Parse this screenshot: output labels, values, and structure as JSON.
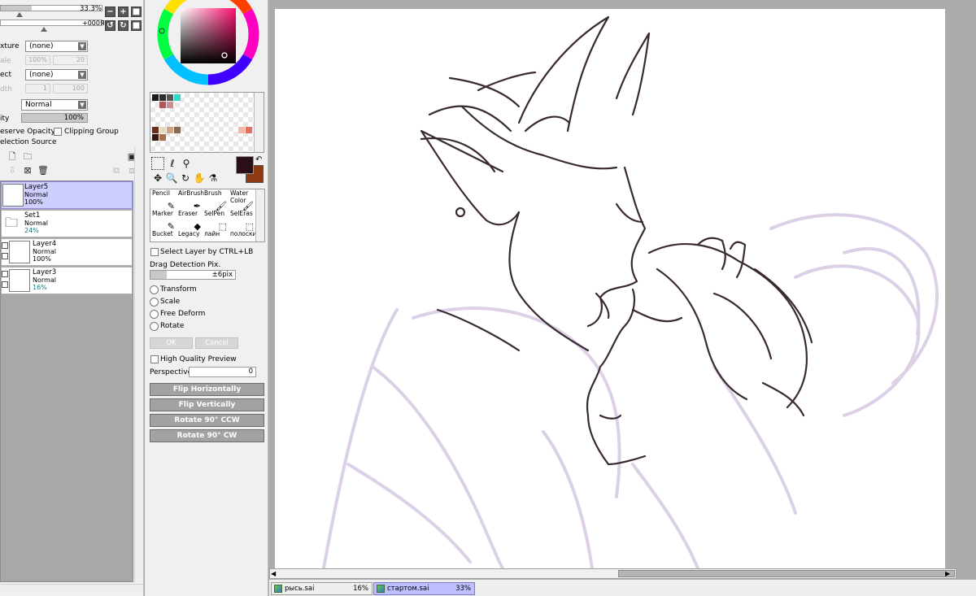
{
  "brush": {
    "size_value": "33.3%",
    "angle_value": "+000Я"
  },
  "texture": {
    "label": "xture",
    "value": "(none)"
  },
  "scale": {
    "label": "ale",
    "value": "100%",
    "num": "20"
  },
  "effect": {
    "label": "ect",
    "value": "(none)"
  },
  "width": {
    "label": "dth",
    "value": "1",
    "num": "100"
  },
  "blend_mode": "Normal",
  "opacity": {
    "label": "ity",
    "value": "100%"
  },
  "preserve_opacity": "eserve Opacity",
  "clipping_group": "Clipping Group",
  "selection_source": "election Source",
  "layers": [
    {
      "name": "Layer5",
      "mode": "Normal",
      "opacity": "100%"
    },
    {
      "name": "Set1",
      "mode": "Normal",
      "opacity": "24%"
    },
    {
      "name": "Layer4",
      "mode": "Normal",
      "opacity": "100%"
    },
    {
      "name": "Layer3",
      "mode": "Normal",
      "opacity": "16%"
    }
  ],
  "colors": {
    "primary": "#2a0f16",
    "secondary": "#8b3a12",
    "accent": "#bfbfff",
    "swatches_row1": [
      "#1a1a1a",
      "#2e2e2e",
      "#555555",
      "#2fd8c8"
    ],
    "swatches_row2": [
      "#b05858",
      "#c89090"
    ],
    "swatches_row3": [
      "#6a2e1a",
      "#e8d8c0",
      "#c8a888",
      "#8a6850"
    ],
    "swatches_row4": [
      "#3a1810",
      "#a87050",
      "#f0b8a8",
      "#e07060"
    ]
  },
  "tools": [
    {
      "label": "Pencil",
      "icon": "pencil-icon"
    },
    {
      "label": "AirBrush",
      "icon": "airbrush-icon"
    },
    {
      "label": "Brush",
      "icon": "brush-icon"
    },
    {
      "label": "Water Color",
      "icon": "watercolor-icon"
    },
    {
      "label": "Marker",
      "icon": "marker-icon"
    },
    {
      "label": "Eraser",
      "icon": "eraser-icon"
    },
    {
      "label": "SelPen",
      "icon": "selpen-icon"
    },
    {
      "label": "SelEras",
      "icon": "seleras-icon"
    },
    {
      "label": "Bucket",
      "icon": "bucket-icon"
    },
    {
      "label": "Legacy",
      "icon": "legacy-icon"
    },
    {
      "label": "лайн",
      "icon": "line-icon"
    },
    {
      "label": "полоски",
      "icon": "stripes-icon"
    }
  ],
  "transform_options": {
    "select_layer": "Select Layer by CTRL+LB",
    "drag_detection_label": "Drag Detection Pix.",
    "drag_detection_value": "±6pix",
    "transform": "Transform",
    "scale": "Scale",
    "free_deform": "Free Deform",
    "rotate": "Rotate",
    "ok": "OK",
    "cancel": "Cancel",
    "high_quality_preview": "High Quality Preview",
    "perspective_label": "Perspective",
    "perspective_value": "0",
    "flip_horizontally": "Flip Horizontally",
    "flip_vertically": "Flip Vertically",
    "rotate_ccw": "Rotate 90° CCW",
    "rotate_cw": "Rotate 90° CW"
  },
  "documents": [
    {
      "name": "рысь.sai",
      "zoom": "16%"
    },
    {
      "name": "стартом.sai",
      "zoom": "33%"
    }
  ]
}
